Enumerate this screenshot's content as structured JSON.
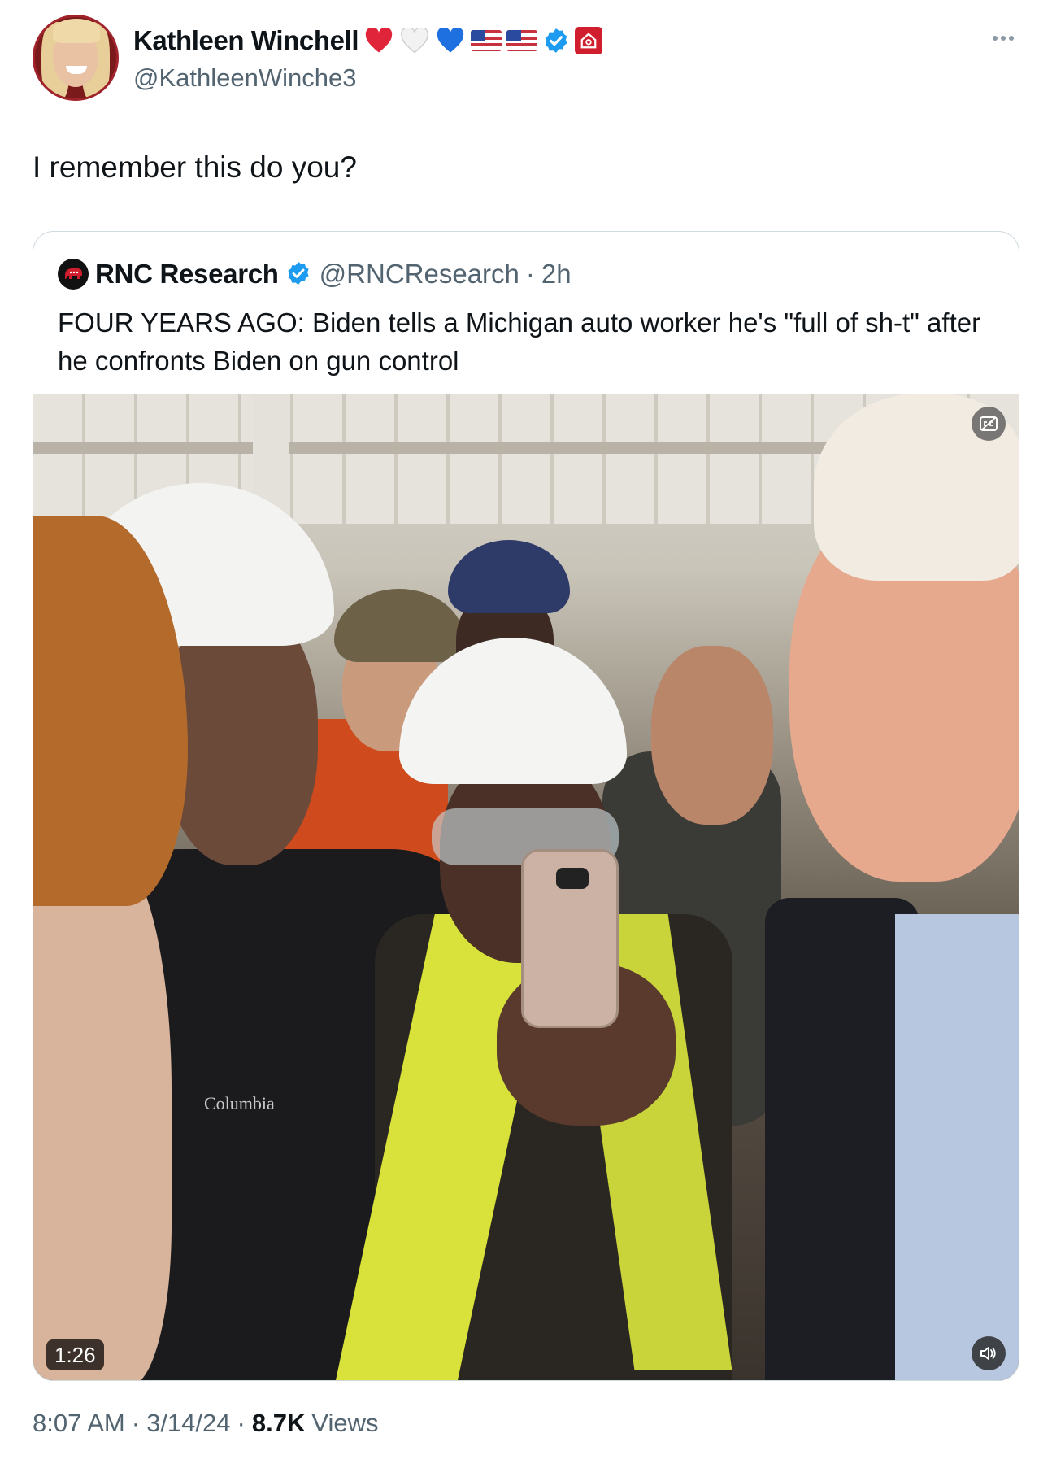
{
  "author": {
    "display_name": "Kathleen Winchell",
    "handle": "@KathleenWinche3",
    "name_emojis": [
      "red-heart",
      "white-heart",
      "blue-heart",
      "us-flag",
      "us-flag"
    ],
    "verified_color": "#1d9bf0",
    "affiliation_badge_color": "#d11e2e"
  },
  "tweet": {
    "text": "I remember this do you?"
  },
  "quoted_tweet": {
    "display_name": "RNC Research",
    "handle": "@RNCResearch",
    "separator": "·",
    "age": "2h",
    "text": "FOUR YEARS AGO: Biden tells a Michigan auto worker he's \"full of sh-t\" after he confronts Biden on gun control",
    "video": {
      "duration": "1:26",
      "shirt_logo_text": "Columbia",
      "cc_icon": "captions-icon",
      "sound_icon": "speaker-icon"
    }
  },
  "footer": {
    "time": "8:07 AM",
    "sep1": "·",
    "date": "3/14/24",
    "sep2": "·",
    "views_count": "8.7K",
    "views_label": "Views"
  },
  "colors": {
    "text_primary": "#0f1419",
    "text_secondary": "#536471",
    "border": "#cfd9de"
  }
}
